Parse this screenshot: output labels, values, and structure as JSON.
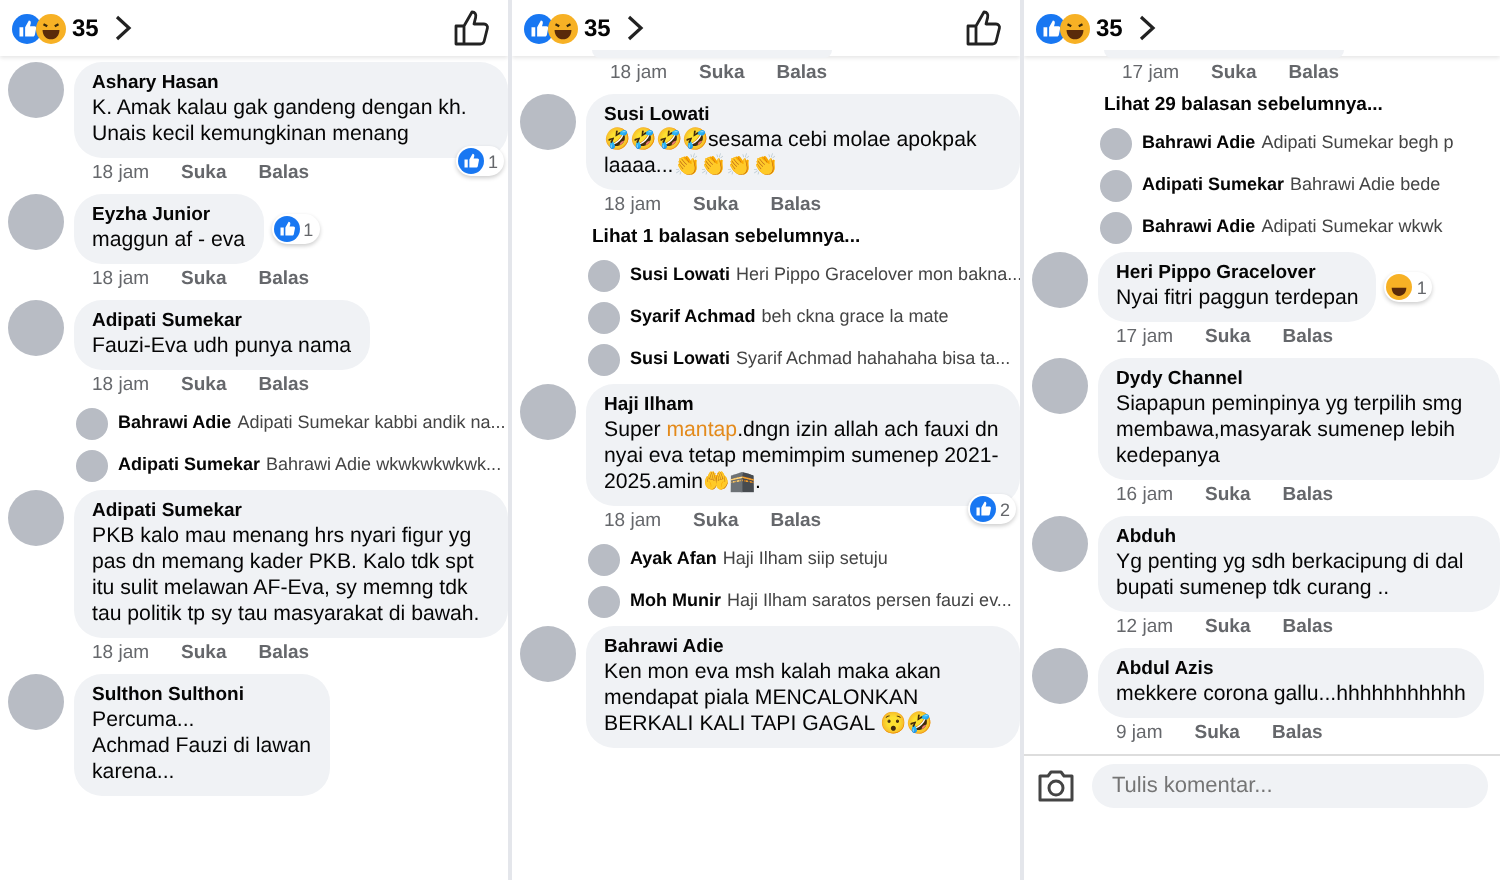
{
  "panels": [
    {
      "reaction_count": "35",
      "like_button": true,
      "items": [
        {
          "kind": "comment",
          "name": "Ashary Hasan",
          "text": "K. Amak kalau gak gandeng dengan kh. Unais kecil kemungkinan menang",
          "time": "18 jam",
          "like": "Suka",
          "reply": "Balas",
          "reaction": {
            "kind": "like",
            "count": "1",
            "overlaps_bubble": true
          }
        },
        {
          "kind": "comment",
          "name": "Eyzha Junior",
          "text": "maggun af - eva",
          "time": "18 jam",
          "like": "Suka",
          "reply": "Balas",
          "reaction": {
            "kind": "like",
            "count": "1",
            "overlaps_bubble": false
          }
        },
        {
          "kind": "comment",
          "name": "Adipati Sumekar",
          "text": "Fauzi-Eva udh punya nama",
          "time": "18 jam",
          "like": "Suka",
          "reply": "Balas"
        },
        {
          "kind": "reply",
          "name": "Bahrawi Adie",
          "text": "Adipati Sumekar kabbi andik na..."
        },
        {
          "kind": "reply",
          "name": "Adipati Sumekar",
          "text": "Bahrawi Adie wkwkwkwkwk..."
        },
        {
          "kind": "comment",
          "name": "Adipati Sumekar",
          "text": "PKB kalo mau menang hrs nyari figur yg pas dn memang kader PKB. Kalo tdk spt itu sulit melawan AF-Eva, sy memng tdk tau politik tp sy tau masyarakat di bawah.",
          "time": "18 jam",
          "like": "Suka",
          "reply": "Balas"
        },
        {
          "kind": "comment",
          "name": "Sulthon Sulthoni",
          "text": "Percuma...\nAchmad Fauzi di lawan\nkarena..."
        }
      ]
    },
    {
      "reaction_count": "35",
      "like_button": true,
      "items": [
        {
          "kind": "meta",
          "time": "18 jam",
          "like": "Suka",
          "reply": "Balas"
        },
        {
          "kind": "comment",
          "name": "Susi Lowati",
          "text": "🤣🤣🤣🤣sesama cebi molae apokpak laaaa...👏👏👏👏",
          "time": "18 jam",
          "like": "Suka",
          "reply": "Balas"
        },
        {
          "kind": "more",
          "text": "Lihat 1 balasan sebelumnya..."
        },
        {
          "kind": "reply",
          "name": "Susi Lowati",
          "text": "Heri Pippo Gracelover mon bakna..."
        },
        {
          "kind": "reply",
          "name": "Syarif Achmad",
          "text": "beh ckna grace la mate"
        },
        {
          "kind": "reply",
          "name": "Susi Lowati",
          "text": "Syarif Achmad hahahaha bisa ta..."
        },
        {
          "kind": "comment",
          "name": "Haji Ilham",
          "text_parts": [
            {
              "kind": "plain",
              "text": "Super "
            },
            {
              "kind": "link",
              "text": "mantap"
            },
            {
              "kind": "plain",
              "text": ".dngn izin allah ach fauxi dn nyai eva tetap memimpim sumenep 2021-2025.amin🤲🕋."
            }
          ],
          "time": "18 jam",
          "like": "Suka",
          "reply": "Balas",
          "reaction": {
            "kind": "like",
            "count": "2",
            "overlaps_bubble": true
          }
        },
        {
          "kind": "reply",
          "name": "Ayak Afan",
          "text": "Haji Ilham siip setuju"
        },
        {
          "kind": "reply",
          "name": "Moh Munir",
          "text": "Haji Ilham saratos persen fauzi ev..."
        },
        {
          "kind": "comment",
          "name": "Bahrawi Adie",
          "text": "Ken mon eva msh kalah maka akan mendapat piala MENCALONKAN BERKALI KALI TAPI GAGAL 😯🤣"
        }
      ]
    },
    {
      "reaction_count": "35",
      "like_button": false,
      "items": [
        {
          "kind": "meta",
          "time": "17 jam",
          "like": "Suka",
          "reply": "Balas"
        },
        {
          "kind": "more",
          "text": "Lihat 29 balasan sebelumnya..."
        },
        {
          "kind": "reply",
          "name": "Bahrawi Adie",
          "text": "Adipati Sumekar begh p"
        },
        {
          "kind": "reply",
          "name": "Adipati Sumekar",
          "text": "Bahrawi Adie bede"
        },
        {
          "kind": "reply",
          "name": "Bahrawi Adie",
          "text": "Adipati Sumekar wkwk"
        },
        {
          "kind": "comment",
          "name": "Heri Pippo Gracelover",
          "text": "Nyai fitri paggun terdepan",
          "time": "17 jam",
          "like": "Suka",
          "reply": "Balas",
          "reaction": {
            "kind": "haha",
            "count": "1",
            "overlaps_bubble": false
          }
        },
        {
          "kind": "comment",
          "name": "Dydy Channel",
          "text": "Siapapun peminpinya yg terpilih smg membawa,masyarak sumenep lebih kedepanya",
          "time": "16 jam",
          "like": "Suka",
          "reply": "Balas"
        },
        {
          "kind": "comment",
          "name": "Abduh",
          "text": "Yg penting yg sdh berkacipung di dal bupati sumenep tdk curang ..",
          "time": "12 jam",
          "like": "Suka",
          "reply": "Balas"
        },
        {
          "kind": "comment",
          "name": "Abdul Azis",
          "text": "mekkere corona gallu...hhhhhhhhhhh",
          "time": "9 jam",
          "like": "Suka",
          "reply": "Balas"
        },
        {
          "kind": "composer",
          "placeholder": "Tulis komentar..."
        }
      ]
    }
  ]
}
